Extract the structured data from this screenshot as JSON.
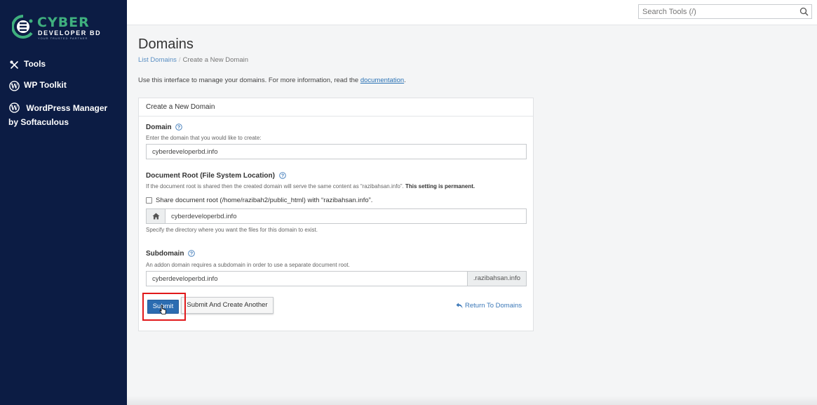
{
  "brand": {
    "name_top": "CYBER",
    "name_mid": "DEVELOPER BD",
    "tagline": "YOUR TRUSTED PARTNER"
  },
  "sidebar": {
    "items": [
      {
        "label": "Tools",
        "icon": "tools-icon"
      },
      {
        "label": "WP Toolkit",
        "icon": "wordpress-icon"
      },
      {
        "label": "WordPress Manager by Softaculous",
        "icon": "wordpress-icon"
      }
    ]
  },
  "search": {
    "placeholder": "Search Tools (/)"
  },
  "page": {
    "title": "Domains",
    "breadcrumb": {
      "parent": "List Domains",
      "separator": "/",
      "current": "Create a New Domain"
    },
    "intro_text": "Use this interface to manage your domains. For more information, read the ",
    "intro_link": "documentation",
    "intro_end": "."
  },
  "form": {
    "panel_title": "Create a New Domain",
    "domain": {
      "label": "Domain",
      "hint": "Enter the domain that you would like to create:",
      "value": "cyberdeveloperbd.info"
    },
    "docroot": {
      "label": "Document Root (File System Location)",
      "hint_text": "If the document root is shared then the created domain will serve the same content as “razibahsan.info”. ",
      "hint_bold": "This setting is permanent.",
      "share_label": "Share document root (/home/razibah2/public_html) with “razibahsan.info”.",
      "share_checked": false,
      "value": "cyberdeveloperbd.info",
      "help_text": "Specify the directory where you want the files for this domain to exist."
    },
    "subdomain": {
      "label": "Subdomain",
      "hint": "An addon domain requires a subdomain in order to use a separate document root.",
      "value": "cyberdeveloperbd.info",
      "suffix": ".razibahsan.info"
    },
    "buttons": {
      "submit": "Submit",
      "submit_another": "Submit And Create Another",
      "return": "Return To Domains"
    }
  },
  "colors": {
    "sidebar_bg": "#0c1c44",
    "brand_green": "#3fb07e",
    "primary": "#2b6cb1",
    "link": "#3b78b8",
    "highlight": "#e1191b"
  }
}
